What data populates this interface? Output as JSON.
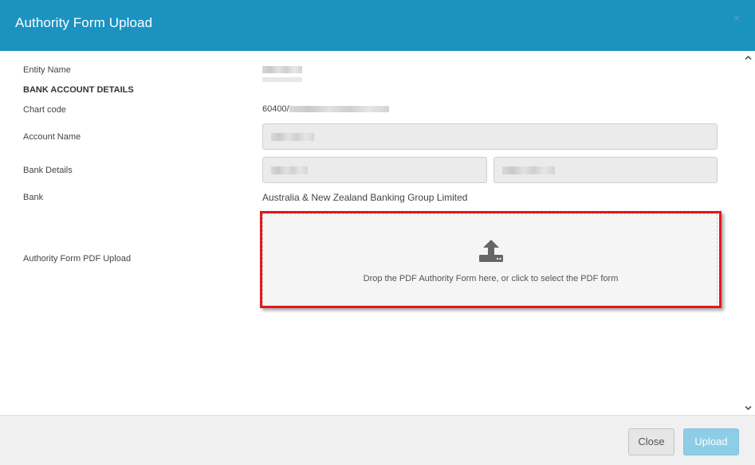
{
  "modal": {
    "title": "Authority Form Upload",
    "close_glyph": "×"
  },
  "form": {
    "entity_name_label": "Entity Name",
    "section_heading": "BANK ACCOUNT DETAILS",
    "chart_code_label": "Chart code",
    "chart_code_value": "60400/",
    "account_name_label": "Account Name",
    "bank_details_label": "Bank Details",
    "bank_label": "Bank",
    "bank_value": "Australia & New Zealand Banking Group Limited",
    "authority_upload_label": "Authority Form PDF Upload"
  },
  "dropzone": {
    "icon": "upload-icon",
    "text": "Drop the PDF Authority Form here, or click to select the PDF form",
    "highlight_color": "#e0191c"
  },
  "footer": {
    "close_label": "Close",
    "upload_label": "Upload"
  },
  "colors": {
    "header": "#1a93c1",
    "upload_button": "#8dcde6"
  }
}
